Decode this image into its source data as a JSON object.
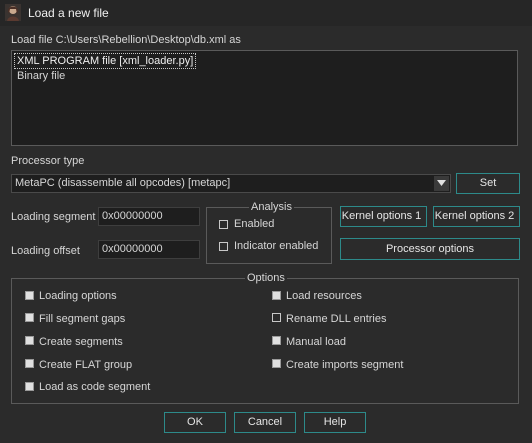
{
  "window": {
    "title": "Load a new file",
    "icon": "person-avatar-icon"
  },
  "load_file_label": "Load file C:\\Users\\Rebellion\\Desktop\\db.xml as",
  "file_types": [
    {
      "label": "XML PROGRAM file [xml_loader.py]",
      "selected": true
    },
    {
      "label": "Binary file",
      "selected": false
    }
  ],
  "processor": {
    "label": "Processor type",
    "value": "MetaPC (disassemble all opcodes) [metapc]",
    "set_label": "Set"
  },
  "segment": {
    "loading_segment_label": "Loading segment",
    "loading_segment_value": "0x00000000",
    "loading_offset_label": "Loading offset",
    "loading_offset_value": "0x00000000"
  },
  "analysis": {
    "title": "Analysis",
    "enabled_label": "Enabled",
    "indicator_label": "Indicator enabled"
  },
  "buttons": {
    "kernel1": "Kernel options 1",
    "kernel2": "Kernel options 2",
    "processor_options": "Processor options",
    "ok": "OK",
    "cancel": "Cancel",
    "help": "Help"
  },
  "options": {
    "title": "Options",
    "loading_options": "Loading options",
    "fill_segment_gaps": "Fill segment gaps",
    "create_segments": "Create segments",
    "create_flat_group": "Create FLAT group",
    "load_as_code_segment": "Load as code segment",
    "load_resources": "Load resources",
    "rename_dll_entries": "Rename DLL entries",
    "manual_load": "Manual load",
    "create_imports_segment": "Create imports segment"
  },
  "colors": {
    "background": "#2b2b2b",
    "accent": "#2d8a8a",
    "field": "#1e1e1e"
  }
}
